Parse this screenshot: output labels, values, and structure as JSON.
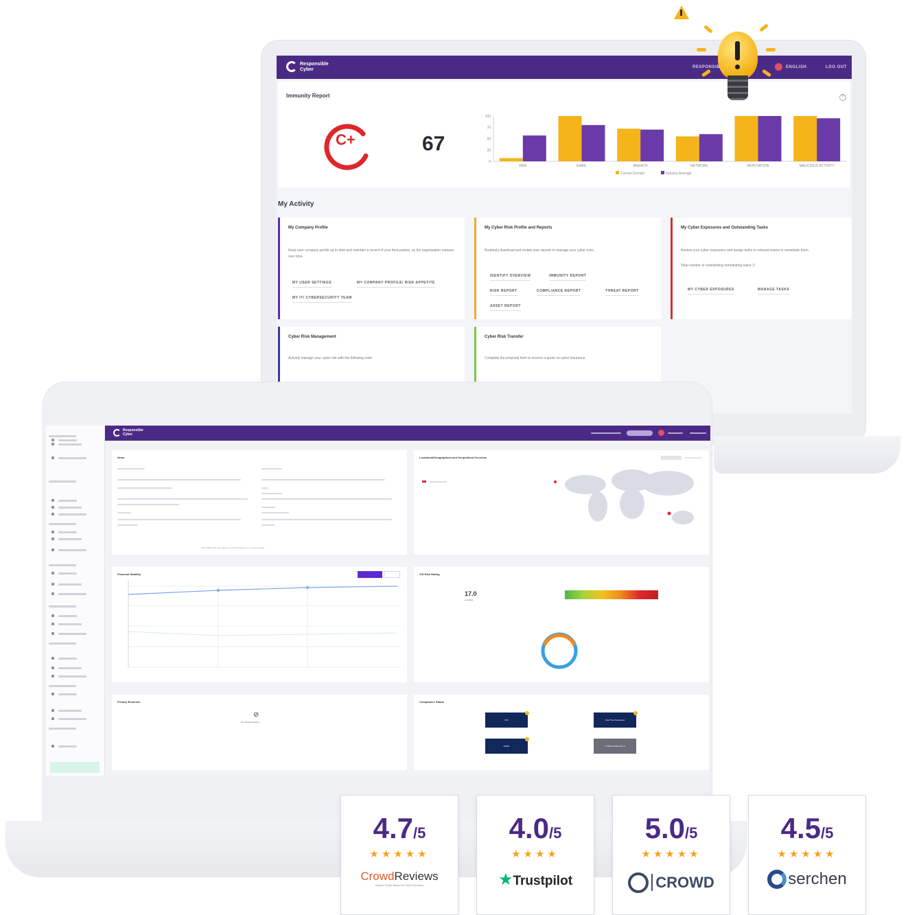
{
  "back_app": {
    "logo_line1": "Responsible",
    "logo_line2": "Cyber",
    "nav": {
      "responsible": "RESPONSIBLE",
      "language": "ENGLISH",
      "logout": "LOG OUT"
    },
    "immunity": {
      "title": "Immunity Report",
      "grade": "C+",
      "score": "67",
      "help": "?"
    },
    "activity_heading": "My Activity",
    "cards": [
      {
        "title": "My Company Profile",
        "desc": "Keep your company profile up to date and maintain a record of your third parties, as the organisation matures over time.",
        "buttons": [
          "MY USER SETTINGS",
          "MY COMPANY PROFILE/ RISK APPETITE",
          "MY IT/ CYBERSECURITY TEAM"
        ],
        "accent": "#5b2bb5"
      },
      {
        "title": "My Cyber Risk Profile and Reports",
        "desc": "Routinely download and review your reports to manage your cyber risks.",
        "buttons": [
          "IDENTIFY OVERVIEW",
          "IMMUNITY REPORT",
          "RISK REPORT",
          "COMPLIANCE REPORT",
          "THREAT REPORT",
          "ASSET REPORT"
        ],
        "accent": "#f5a623"
      },
      {
        "title": "My Cyber Exposures and Outstanding Tasks",
        "desc": "Review your cyber exposures and assign tasks to relevant teams to remediate them.",
        "extra": "Total number of outstanding remediating tasks: 0",
        "buttons": [
          "MY CYBER EXPOSURES",
          "MANAGE TASKS"
        ],
        "accent": "#d0342c"
      },
      {
        "title": "Cyber Risk Management",
        "desc": "Actively manage your cyber risk with the following tools",
        "buttons": [],
        "accent": "#3a3aa0"
      },
      {
        "title": "Cyber Risk Transfer",
        "desc": "Complete the proposal form to receive a quote on cyber insurance.",
        "buttons": [],
        "accent": "#7cc44a"
      }
    ]
  },
  "chart_data": {
    "type": "bar",
    "categories": [
      "WEB",
      "EMAIL",
      "BREACH",
      "NETWORK",
      "REPUTATION",
      "MALICIOUS ACTIVITY"
    ],
    "series": [
      {
        "name": "Current Domain",
        "values": [
          7,
          100,
          72,
          55,
          100,
          100
        ],
        "color": "#f5b41a"
      },
      {
        "name": "Industry Average",
        "values": [
          57,
          80,
          70,
          60,
          100,
          95
        ],
        "color": "#6a3aa8"
      }
    ],
    "y_ticks": [
      "100",
      "75",
      "50",
      "25",
      "0"
    ],
    "ylim": [
      0,
      100
    ],
    "legend": "bottom"
  },
  "front_app": {
    "logo_line1": "Responsible",
    "logo_line2": "Cyber",
    "cards": {
      "news": "News",
      "map": "Locational/Geographical and Geopolitical Overview",
      "stability": "Financial Stability",
      "risk_rating": "VIS Risk Rating",
      "risk_value": "17.0",
      "risk_label": "Low Risk",
      "privacy": "Privacy Breaches",
      "privacy_empty": "No privacy breaches",
      "compliance": "Compliance Status",
      "news_footer": "This updates the news daily. No current breaches. It is recommended."
    },
    "compliance_buttons": [
      "PCI",
      "View The Procedures",
      "GDPR",
      "CYBER ESSENTIALS"
    ]
  },
  "ratings": [
    {
      "value": "4.7",
      "denom": "/5",
      "stars": "★★★★★",
      "brand": "CrowdReviews",
      "brand_sub": "Buyers Guide Based on Client Reviews"
    },
    {
      "value": "4.0",
      "denom": "/5",
      "stars": "★★★★",
      "brand": "Trustpilot"
    },
    {
      "value": "5.0",
      "denom": "/5",
      "stars": "★★★★★",
      "brand": "CROWD"
    },
    {
      "value": "4.5",
      "denom": "/5",
      "stars": "★★★★★",
      "brand": "serchen"
    }
  ]
}
